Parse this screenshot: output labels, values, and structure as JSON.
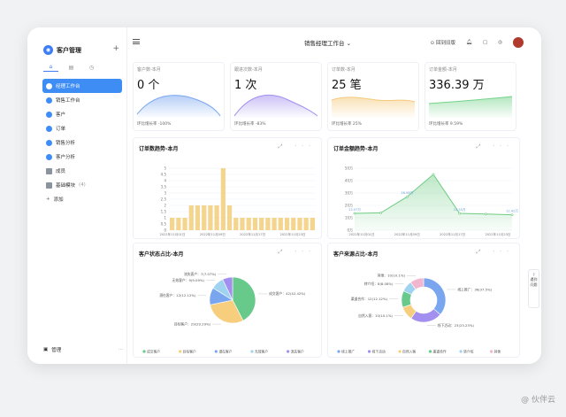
{
  "sidebar": {
    "app_name": "客户管理",
    "items": [
      {
        "label": "经理工作台",
        "active": true
      },
      {
        "label": "销售工作台"
      },
      {
        "label": "客户"
      },
      {
        "label": "订单"
      },
      {
        "label": "销售分析"
      },
      {
        "label": "客户分析"
      },
      {
        "label": "成员"
      },
      {
        "label": "基础模块",
        "count": "(4)"
      },
      {
        "label": "添加"
      }
    ],
    "footer": "管理"
  },
  "topbar": {
    "title": "销售经理工作台",
    "help_label": "回到旧版"
  },
  "kpis": [
    {
      "title": "客户数-本月",
      "value": "0 个",
      "foot": "环比增长率 -100%",
      "color": "#7aa6f0"
    },
    {
      "title": "跟进次数-本月",
      "value": "1 次",
      "foot": "环比增长率 -83%",
      "color": "#a28ff0"
    },
    {
      "title": "订单数-本月",
      "value": "25 笔",
      "foot": "环比增长率 25%",
      "color": "#f4c97a"
    },
    {
      "title": "订单金额-本月",
      "value": "336.39 万",
      "foot": "环比增长率 9.59%",
      "color": "#74d38a"
    }
  ],
  "chart_data": [
    {
      "type": "bar",
      "title": "订单数趋势-本月",
      "categories": [
        "d1",
        "d2",
        "d3",
        "d4",
        "d5",
        "d6",
        "d7",
        "d8",
        "d9",
        "d10",
        "d11",
        "d12",
        "d13",
        "d14",
        "d15",
        "d16",
        "d17",
        "d18",
        "d19",
        "d20",
        "d21",
        "d22",
        "d23"
      ],
      "values": [
        1,
        1,
        1,
        2,
        2,
        2,
        2,
        2,
        5,
        2,
        1,
        1,
        1,
        1,
        1,
        1,
        1,
        1,
        1,
        1,
        1,
        1,
        1
      ],
      "tick_labels": [
        "2022年11月01日",
        "2022年11月09日",
        "2022年11月17日",
        "2022年11月23日"
      ],
      "ylim": [
        0,
        5
      ],
      "color": "#f5d48e"
    },
    {
      "type": "area",
      "title": "订单金额趋势-本月",
      "x": [
        "2022年11月01日",
        "2022年11月05日",
        "2022年11月09日",
        "2022年11月13日",
        "2022年11月17日",
        "2022年11月21日",
        "2022年11月23日"
      ],
      "values": [
        13.57,
        14,
        26.98,
        45,
        13.55,
        13,
        12.42
      ],
      "labels": [
        "13.57万",
        "",
        "26.98万",
        "",
        "13.55万",
        "",
        "12.42万"
      ],
      "tick_labels": [
        "2022年11月01日",
        "2022年11月09日",
        "2022年11月17日",
        "2022年11月23日"
      ],
      "ylim": [
        0,
        50
      ],
      "color": "#6dcc83"
    },
    {
      "type": "pie",
      "title": "客户状态占比-本月",
      "slices": [
        {
          "name": "成交客户",
          "value": 42,
          "pct": "42.42%",
          "label": "成交客户：42(42.42%)",
          "color": "#67c98a"
        },
        {
          "name": "目标客户",
          "value": 29,
          "pct": "29.29%",
          "label": "目标客户：29(29.29%)",
          "color": "#f6ce7d"
        },
        {
          "name": "潜在客户",
          "value": 12,
          "pct": "12.12%",
          "label": "潜在客户：12(12.12%)",
          "color": "#7aa6f0"
        },
        {
          "name": "无效客户",
          "value": 9,
          "pct": "9.09%",
          "label": "无效客户：9(9.09%)",
          "color": "#9fd3ef"
        },
        {
          "name": "流失客户",
          "value": 7,
          "pct": "7.07%",
          "label": "流失客户：7(7.07%)",
          "color": "#a28ff0"
        }
      ]
    },
    {
      "type": "pie",
      "title": "客户来源占比-本月",
      "donut": true,
      "slices": [
        {
          "name": "线上推广",
          "value": 36,
          "pct": "37.5%",
          "label": "线上推广：36(37.5%)",
          "color": "#7aa6f0"
        },
        {
          "name": "线下活动",
          "value": 23,
          "pct": "23.23%",
          "label": "线下活动：23(23.23%)",
          "color": "#a28ff0"
        },
        {
          "name": "自然入客",
          "value": 10,
          "pct": "10.1%",
          "label": "自然入客：10(10.1%)",
          "color": "#f6ce7d"
        },
        {
          "name": "渠道合作",
          "value": 12,
          "pct": "12.12%",
          "label": "渠道合作：12(12.12%)",
          "color": "#67c98a"
        },
        {
          "name": "转介绍",
          "value": 8,
          "pct": "8.08%",
          "label": "转介绍：8(8.08%)",
          "color": "#9fd3ef"
        },
        {
          "name": "其他",
          "value": 10,
          "pct": "10.1%",
          "label": "其他：10(10.1%)",
          "color": "#f3b6cf"
        }
      ]
    }
  ],
  "help": {
    "label": "遇到问题"
  },
  "watermark": "@ 伙伴云"
}
